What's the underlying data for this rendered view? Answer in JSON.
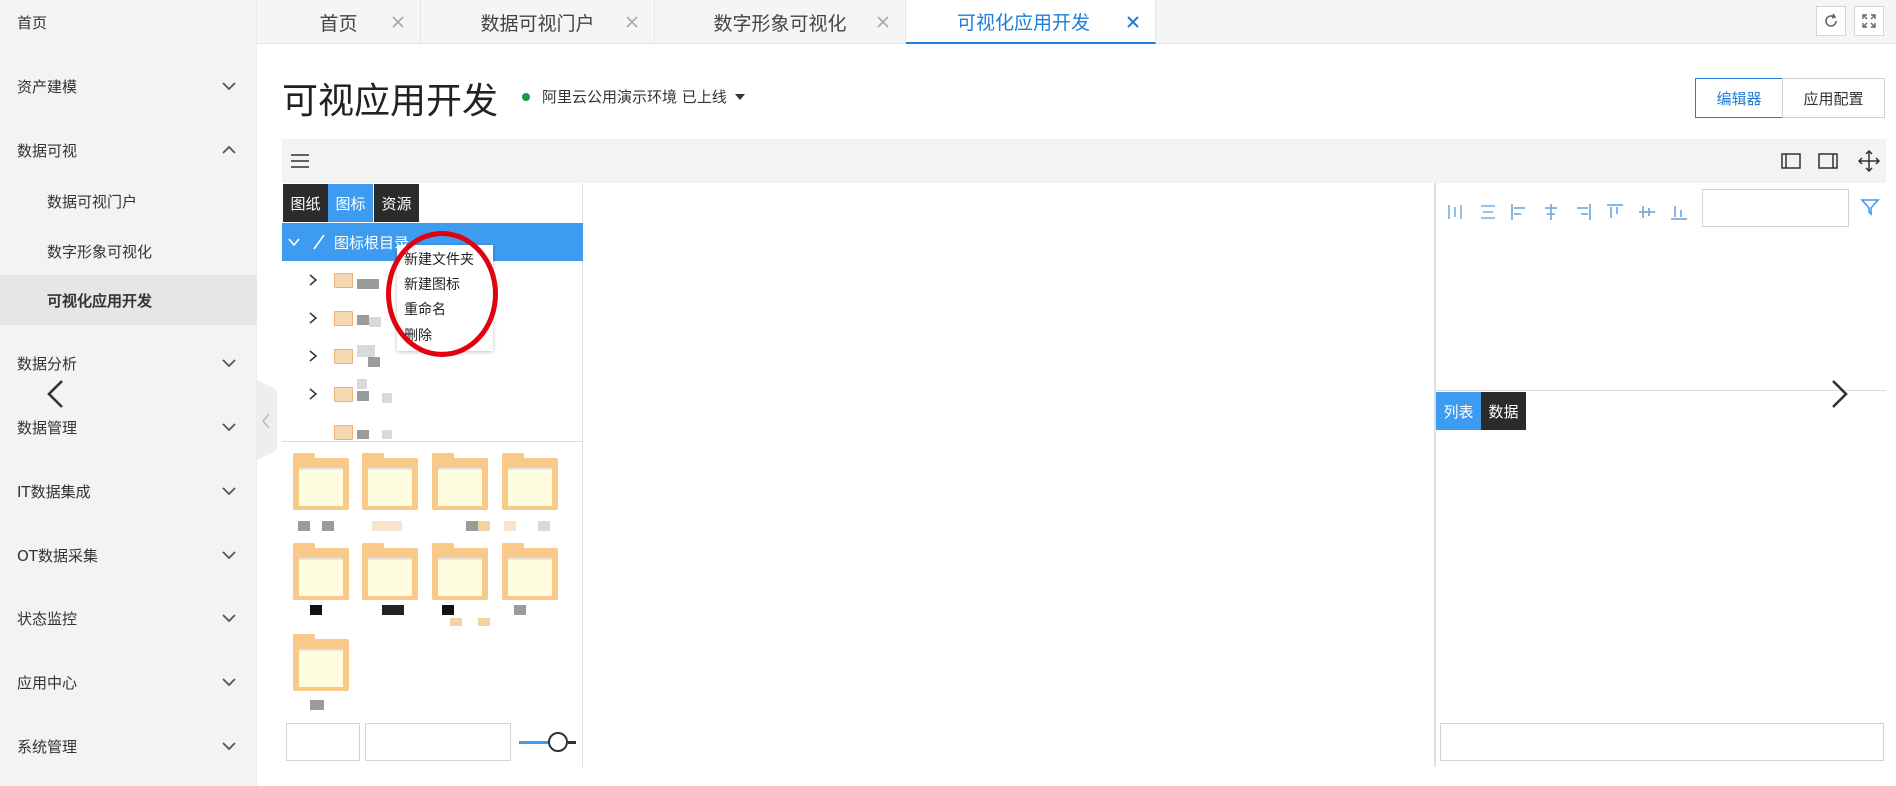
{
  "sidebar": {
    "items": [
      {
        "label": "首页"
      },
      {
        "label": "资产建模"
      },
      {
        "label": "数据可视"
      },
      {
        "label": "数据可视门户"
      },
      {
        "label": "数字形象可视化"
      },
      {
        "label": "可视化应用开发"
      },
      {
        "label": "数据分析"
      },
      {
        "label": "数据管理"
      },
      {
        "label": "IT数据集成"
      },
      {
        "label": "OT数据采集"
      },
      {
        "label": "状态监控"
      },
      {
        "label": "应用中心"
      },
      {
        "label": "系统管理"
      }
    ]
  },
  "tabs": [
    {
      "label": "首页"
    },
    {
      "label": "数据可视门户"
    },
    {
      "label": "数字形象可视化"
    },
    {
      "label": "可视化应用开发"
    }
  ],
  "header": {
    "title": "可视应用开发",
    "env": "阿里云公用演示环境 已上线",
    "editor_btn": "编辑器",
    "config_btn": "应用配置"
  },
  "left_panel": {
    "tabs": [
      {
        "label": "图纸"
      },
      {
        "label": "图标"
      },
      {
        "label": "资源"
      }
    ],
    "root": "图标根目录"
  },
  "context_menu": {
    "items": [
      {
        "label": "新建文件夹"
      },
      {
        "label": "新建图标"
      },
      {
        "label": "重命名"
      },
      {
        "label": "删除"
      }
    ]
  },
  "right_panel": {
    "tabs": [
      {
        "label": "列表"
      },
      {
        "label": "数据"
      }
    ]
  },
  "colors": {
    "accent": "#1e7ed8",
    "selected": "#3d9cf0",
    "annotation_circle": "#e3000f"
  }
}
